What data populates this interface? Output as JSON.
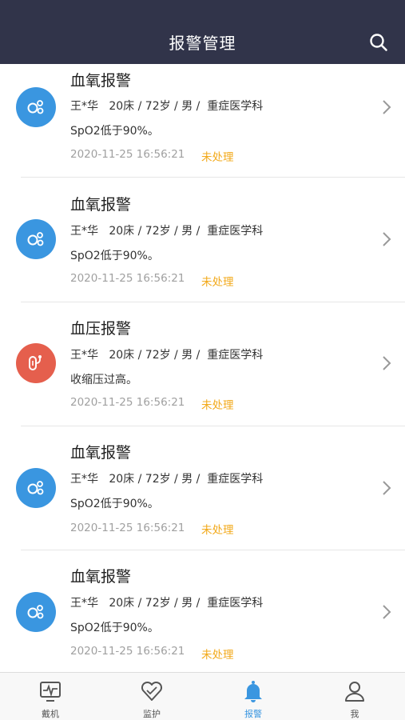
{
  "header": {
    "title": "报警管理"
  },
  "alarms": [
    {
      "type": "oxygen",
      "title": "血氧报警",
      "patient": "王*华   20床 / 72岁 / 男 /  重症医学科",
      "desc": "SpO2低于90%。",
      "time": "2020-11-25 16:56:21",
      "status": "未处理"
    },
    {
      "type": "oxygen",
      "title": "血氧报警",
      "patient": "王*华   20床 / 72岁 / 男 /  重症医学科",
      "desc": "SpO2低于90%。",
      "time": "2020-11-25 16:56:21",
      "status": "未处理"
    },
    {
      "type": "pressure",
      "title": "血压报警",
      "patient": "王*华   20床 / 72岁 / 男 /  重症医学科",
      "desc": "收缩压过高。",
      "time": "2020-11-25 16:56:21",
      "status": "未处理"
    },
    {
      "type": "oxygen",
      "title": "血氧报警",
      "patient": "王*华   20床 / 72岁 / 男 /  重症医学科",
      "desc": "SpO2低于90%。",
      "time": "2020-11-25 16:56:21",
      "status": "未处理"
    },
    {
      "type": "oxygen",
      "title": "血氧报警",
      "patient": "王*华   20床 / 72岁 / 男 /  重症医学科",
      "desc": "SpO2低于90%。",
      "time": "2020-11-25 16:56:21",
      "status": "未处理"
    }
  ],
  "tabs": [
    {
      "label": "戴机",
      "icon": "monitor-icon",
      "active": false
    },
    {
      "label": "监护",
      "icon": "heart-icon",
      "active": false
    },
    {
      "label": "报警",
      "icon": "bell-icon",
      "active": true
    },
    {
      "label": "我",
      "icon": "person-icon",
      "active": false
    }
  ],
  "colors": {
    "header_bg": "#31344a",
    "oxygen_icon": "#3a96e0",
    "pressure_icon": "#e55f4d",
    "status": "#f2a91a",
    "active_tab": "#3a96e0"
  }
}
